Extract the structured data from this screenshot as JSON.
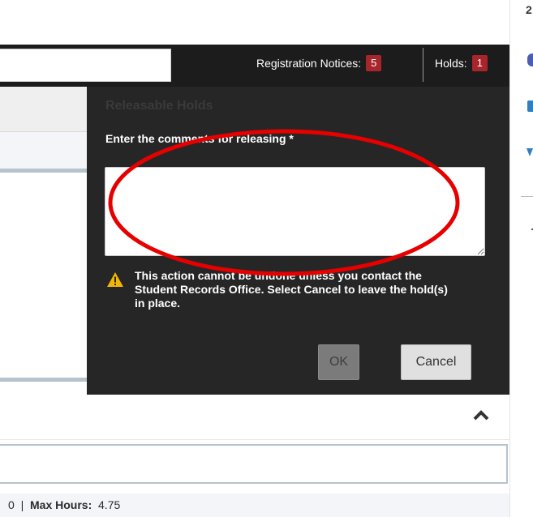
{
  "header": {
    "registration_notices_label": "Registration Notices:",
    "registration_notices_count": "5",
    "holds_label": "Holds:",
    "holds_count": "1",
    "badge_color": "#a8252c"
  },
  "dialog": {
    "title": "Releasable Holds",
    "comment_label": "Enter the comments for releasing *",
    "comment_value": "",
    "warning_icon": "warning-triangle-icon",
    "warning_text": "This action cannot be undone unless you contact the Student Records Office. Select Cancel to leave the hold(s) in place.",
    "ok_label": "OK",
    "cancel_label": "Cancel"
  },
  "annotation": {
    "shape": "ellipse",
    "color": "#e60000"
  },
  "lower": {
    "collapse_icon": "chevron-up-icon",
    "hours_prefix": "0",
    "hours_separator": "|",
    "max_hours_label": "Max Hours:",
    "max_hours_value": "4.75"
  },
  "right_sidebar": {
    "top_glyph": "2"
  }
}
